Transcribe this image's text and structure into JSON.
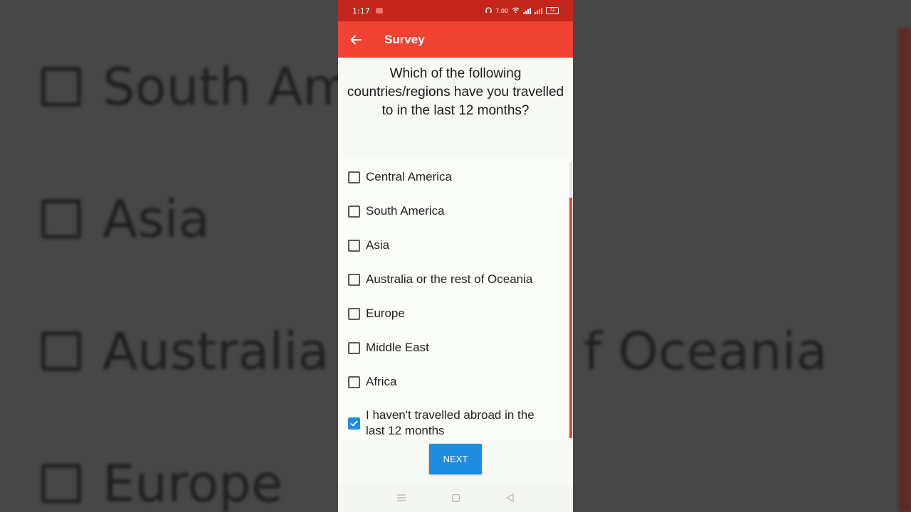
{
  "status_bar": {
    "time": "1:17",
    "speed": "7.00",
    "battery": "72"
  },
  "app_bar": {
    "title": "Survey"
  },
  "question": "Which of the following countries/regions have you travelled to in the last 12 months?",
  "options": [
    {
      "label": "Central America",
      "checked": false
    },
    {
      "label": "South America",
      "checked": false
    },
    {
      "label": "Asia",
      "checked": false
    },
    {
      "label": "Australia or the rest of Oceania",
      "checked": false
    },
    {
      "label": "Europe",
      "checked": false
    },
    {
      "label": "Middle East",
      "checked": false
    },
    {
      "label": "Africa",
      "checked": false
    },
    {
      "label": "I haven't travelled abroad in the last 12 months",
      "checked": true
    }
  ],
  "next_label": "NEXT",
  "background_zoom": {
    "items": [
      "South Ame",
      "Asia",
      "Australia o",
      "f Oceania",
      "Europe"
    ]
  },
  "colors": {
    "status_bar": "#c4261b",
    "app_bar": "#f04232",
    "accent": "#1f8ddf"
  }
}
